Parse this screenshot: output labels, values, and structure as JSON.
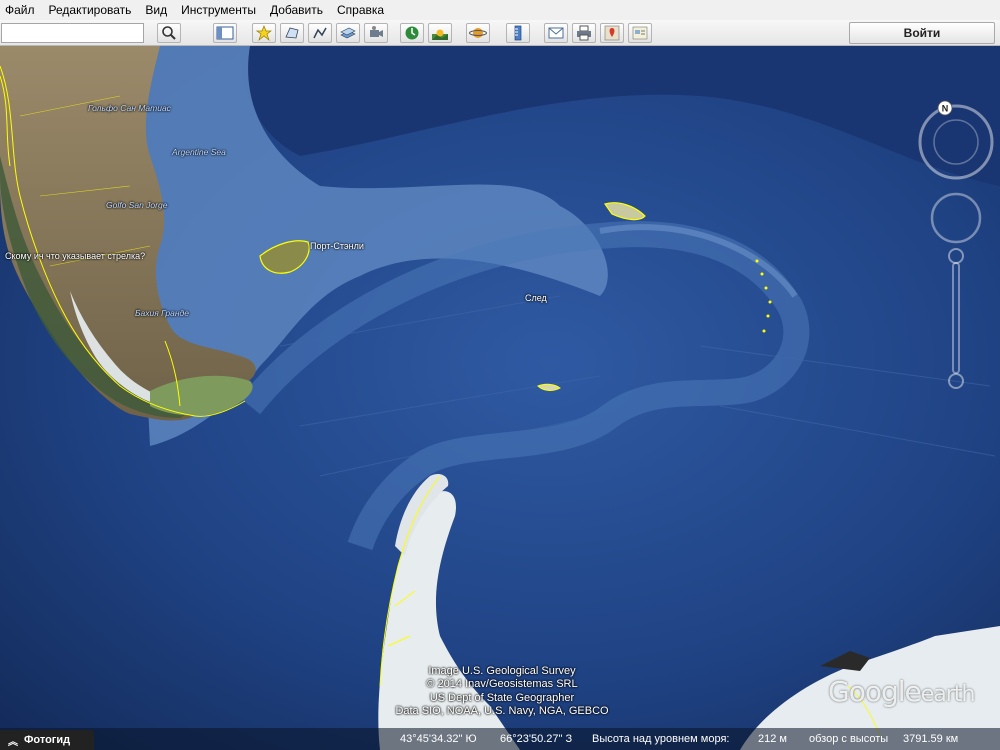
{
  "menu": {
    "items": [
      "Файл",
      "Редактировать",
      "Вид",
      "Инструменты",
      "Добавить",
      "Справка"
    ]
  },
  "toolbar": {
    "search_value": "",
    "signin_label": "Войти",
    "buttons": [
      "search-icon",
      "sidebar-icon",
      "placemark-icon",
      "polygon-icon",
      "path-icon",
      "image-overlay-icon",
      "tour-icon",
      "historical-imagery-icon",
      "sunlight-icon",
      "planets-icon",
      "ruler-icon",
      "email-icon",
      "print-icon",
      "google-maps-icon",
      "kml-icon"
    ]
  },
  "map": {
    "labels": {
      "golfo_san_matias": "Гольфо Сан Матиас",
      "argentine_sea": "Argentine Sea",
      "golfo_san_jorge": "Golfo San Jorge",
      "rio_grande": "Бахия Гранде",
      "arrow_hint": "Скому ич что указывает стрелка?",
      "port_stanley": "Порт-Стэнли",
      "trace": "След"
    },
    "colors": {
      "ocean_deep": "#142c5c",
      "ocean": "#2a5196",
      "shelf": "#5c84bd",
      "land": "#8a7a5e",
      "border": "#ffff00",
      "ice": "#e6ecef"
    }
  },
  "attribution": {
    "line1": "Image U.S. Geological Survey",
    "line2": "© 2014 Inav/Geosistemas SRL",
    "line3": "US Dept of State Geographer",
    "line4": "Data SIO, NOAA, U.S. Navy, NGA, GEBCO"
  },
  "logo": {
    "google": "Google",
    "earth": "earth"
  },
  "status": {
    "photos_label": "Фотогид",
    "latitude": "43°45'34.32\" Ю",
    "longitude": "66°23'50.27\" З",
    "elevation_label": "Высота над уровнем моря:",
    "elevation_value": "212 м",
    "eye_alt_label": "обзор с высоты",
    "eye_alt_value": "3791.59 км"
  }
}
